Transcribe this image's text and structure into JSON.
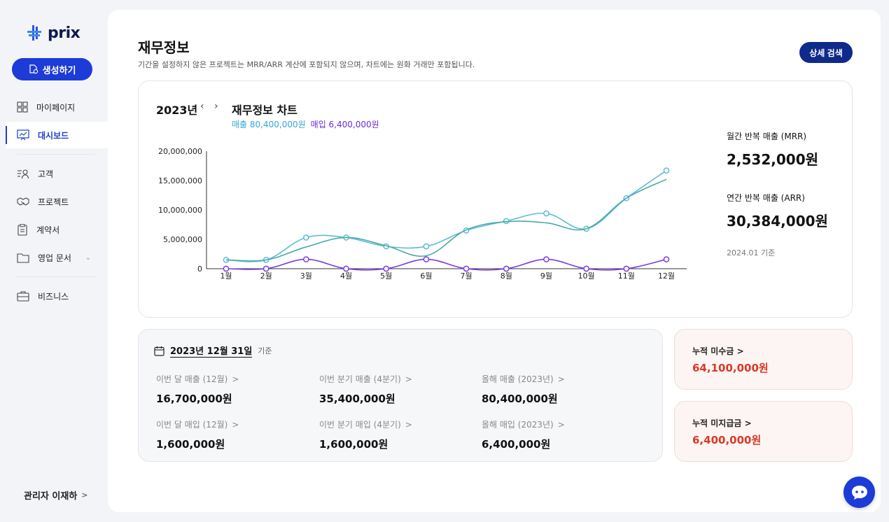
{
  "app": {
    "logo_text": "prix"
  },
  "sidebar": {
    "create_label": "생성하기",
    "items": [
      {
        "label": "마이페이지",
        "icon": "grid-icon"
      },
      {
        "label": "대시보드",
        "icon": "chart-board-icon",
        "active": true
      },
      {
        "label": "고객",
        "icon": "users-icon"
      },
      {
        "label": "프로젝트",
        "icon": "handshake-icon"
      },
      {
        "label": "계약서",
        "icon": "clipboard-icon"
      },
      {
        "label": "영업 문서",
        "icon": "folder-icon"
      },
      {
        "label": "비즈니스",
        "icon": "briefcase-icon"
      }
    ],
    "admin_label": "관리자 이재하"
  },
  "header": {
    "title": "재무정보",
    "subtitle": "기간을 설정하지 않은 프로젝트는 MRR/ARR 계산에 포함되지 않으며, 차트에는 원화 거래만 포함됩니다.",
    "detail_button": "상세 검색"
  },
  "chart_card": {
    "year": "2023년",
    "title": "재무정보 차트",
    "legend_revenue": "매출 80,400,000원",
    "legend_purchase": "매입 6,400,000원",
    "mrr_label": "월간 반복 매출 (MRR)",
    "mrr_value": "2,532,000원",
    "arr_label": "연간 반복 매출 (ARR)",
    "arr_value": "30,384,000원",
    "asof": "2024.01 기준"
  },
  "chart_data": {
    "type": "line",
    "categories": [
      "1월",
      "2월",
      "3월",
      "4월",
      "5월",
      "6월",
      "7월",
      "8월",
      "9월",
      "10월",
      "11월",
      "12월"
    ],
    "ylim": [
      0,
      20000000
    ],
    "yticks": [
      "0",
      "5,000,000",
      "10,000,000",
      "15,000,000",
      "20,000,000"
    ],
    "colors": {
      "revenue": "#5bbcd8",
      "revenue_alt": "#4aa9a8",
      "purchase": "#7a3be3"
    },
    "series": [
      {
        "name": "매출",
        "values": [
          1500000,
          1500000,
          5300000,
          5300000,
          3800000,
          3800000,
          6500000,
          8100000,
          9400000,
          6800000,
          12000000,
          16700000
        ]
      },
      {
        "values": [
          1500000,
          1500000,
          3700000,
          5300000,
          3900000,
          2200000,
          6600000,
          8000000,
          7800000,
          6800000,
          12000000,
          15200000
        ]
      },
      {
        "name": "매입",
        "values": [
          0,
          0,
          1600000,
          0,
          0,
          1600000,
          0,
          0,
          1600000,
          0,
          0,
          1600000
        ]
      }
    ]
  },
  "summary": {
    "date": "2023년 12월 31일",
    "basis": "기준",
    "stats": [
      {
        "label": "이번 달 매출 (12월)",
        "value": "16,700,000원"
      },
      {
        "label": "이번 분기 매출 (4분기)",
        "value": "35,400,000원"
      },
      {
        "label": "올해 매출 (2023년)",
        "value": "80,400,000원"
      },
      {
        "label": "이번 달 매입 (12월)",
        "value": "1,600,000원"
      },
      {
        "label": "이번 분기 매입 (4분기)",
        "value": "1,600,000원"
      },
      {
        "label": "올해 매입 (2023년)",
        "value": "6,400,000원"
      }
    ]
  },
  "receivables": {
    "label": "누적 미수금",
    "value": "64,100,000원"
  },
  "payables": {
    "label": "누적 미지급금",
    "value": "6,400,000원"
  }
}
